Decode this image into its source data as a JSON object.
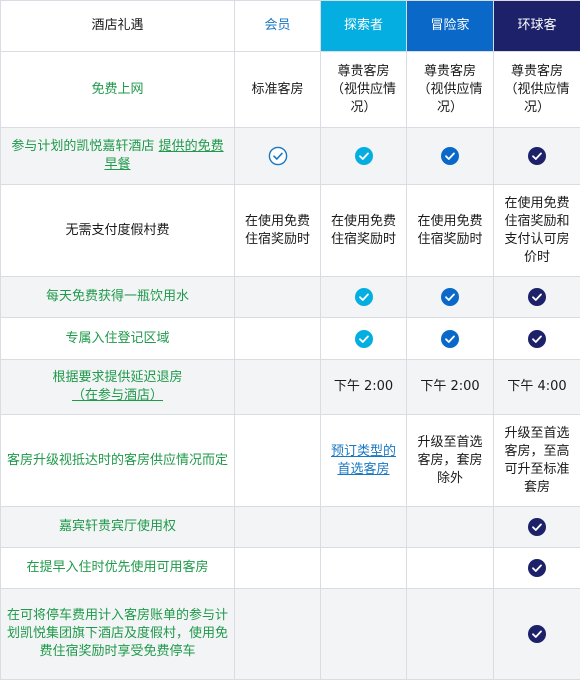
{
  "header": {
    "feature": "酒店礼遇",
    "member": "会员",
    "explorer": "探索者",
    "adventurer": "冒险家",
    "globalist": "环球客"
  },
  "colors": {
    "explorer": "#05aee0",
    "adventurer": "#0a68c9",
    "globalist": "#1c2169",
    "member_text": "#1a78c2",
    "feature_link": "#1f9a4a"
  },
  "rows": [
    {
      "feature": "免费上网",
      "member": "标准客房",
      "explorer": "尊贵客房（视供应情况）",
      "adventurer": "尊贵客房（视供应情况）",
      "globalist": "尊贵客房（视供应情况）"
    },
    {
      "feature_prefix": "参与计划的凯悦嘉轩酒店 ",
      "feature_link": "提供的免费早餐",
      "member_icon": "check-circle-outline-icon",
      "explorer_icon": "check-circle-filled-icon",
      "adventurer_icon": "check-circle-filled-icon",
      "globalist_icon": "check-circle-filled-icon"
    },
    {
      "feature": "无需支付度假村费",
      "member": "在使用免费住宿奖励时",
      "explorer": "在使用免费住宿奖励时",
      "adventurer": "在使用免费住宿奖励时",
      "globalist": "在使用免费住宿奖励和支付认可房价时"
    },
    {
      "feature": "每天免费获得一瓶饮用水",
      "explorer_icon": "check-circle-filled-icon",
      "adventurer_icon": "check-circle-filled-icon",
      "globalist_icon": "check-circle-filled-icon"
    },
    {
      "feature": "专属入住登记区域",
      "explorer_icon": "check-circle-filled-icon",
      "adventurer_icon": "check-circle-filled-icon",
      "globalist_icon": "check-circle-filled-icon"
    },
    {
      "feature_prefix": "根据要求提供延迟退房",
      "feature_link": "（在参与酒店）",
      "explorer": "下午 2:00",
      "adventurer": "下午 2:00",
      "globalist": "下午 4:00"
    },
    {
      "feature": "客房升级视抵达时的客房供应情况而定",
      "explorer_link": "预订类型的首选客房",
      "adventurer": "升级至首选客房，套房除外",
      "globalist": "升级至首选客房，至高可升至标准套房"
    },
    {
      "feature": "嘉宾轩贵宾厅使用权",
      "globalist_icon": "check-circle-filled-icon"
    },
    {
      "feature": "在提早入住时优先使用可用客房",
      "globalist_icon": "check-circle-filled-icon"
    },
    {
      "feature": "在可将停车费用计入客房账单的参与计划凯悦集团旗下酒店及度假村，使用免费住宿奖励时享受免费停车",
      "globalist_icon": "check-circle-filled-icon"
    }
  ]
}
